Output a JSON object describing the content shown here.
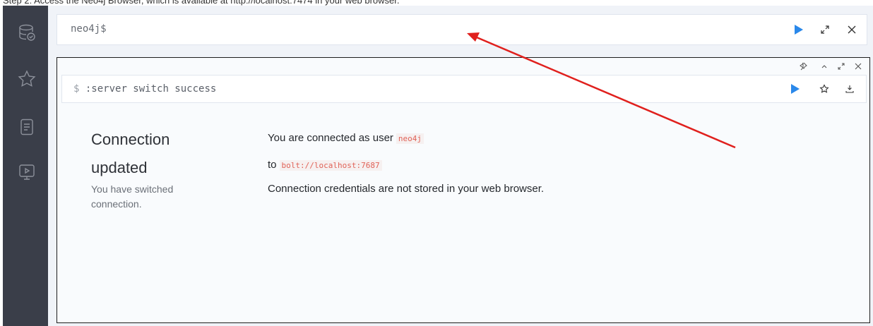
{
  "caption": "Step 2: Access the Neo4j Browser, which is available at http://localhost:7474 in your web browser.",
  "sidebar": {
    "items": [
      {
        "icon": "database-icon"
      },
      {
        "icon": "star-icon"
      },
      {
        "icon": "document-icon"
      },
      {
        "icon": "monitor-play-icon"
      }
    ]
  },
  "editor": {
    "prompt": "neo4j$"
  },
  "frame": {
    "command_prefix": "$",
    "command": ":server switch success",
    "title_line1": "Connection",
    "title_line2": "updated",
    "subtitle_line1": "You have switched",
    "subtitle_line2": "connection.",
    "connected_text": "You are connected as user",
    "user": "neo4j",
    "to_text": "to",
    "url": "bolt://localhost:7687",
    "credentials_note": "Connection credentials are not stored in your web browser."
  },
  "colors": {
    "sidebar": "#3a3e49",
    "play": "#2a88ea",
    "annotation_arrow": "#e0201d",
    "code_text": "#e06257"
  }
}
